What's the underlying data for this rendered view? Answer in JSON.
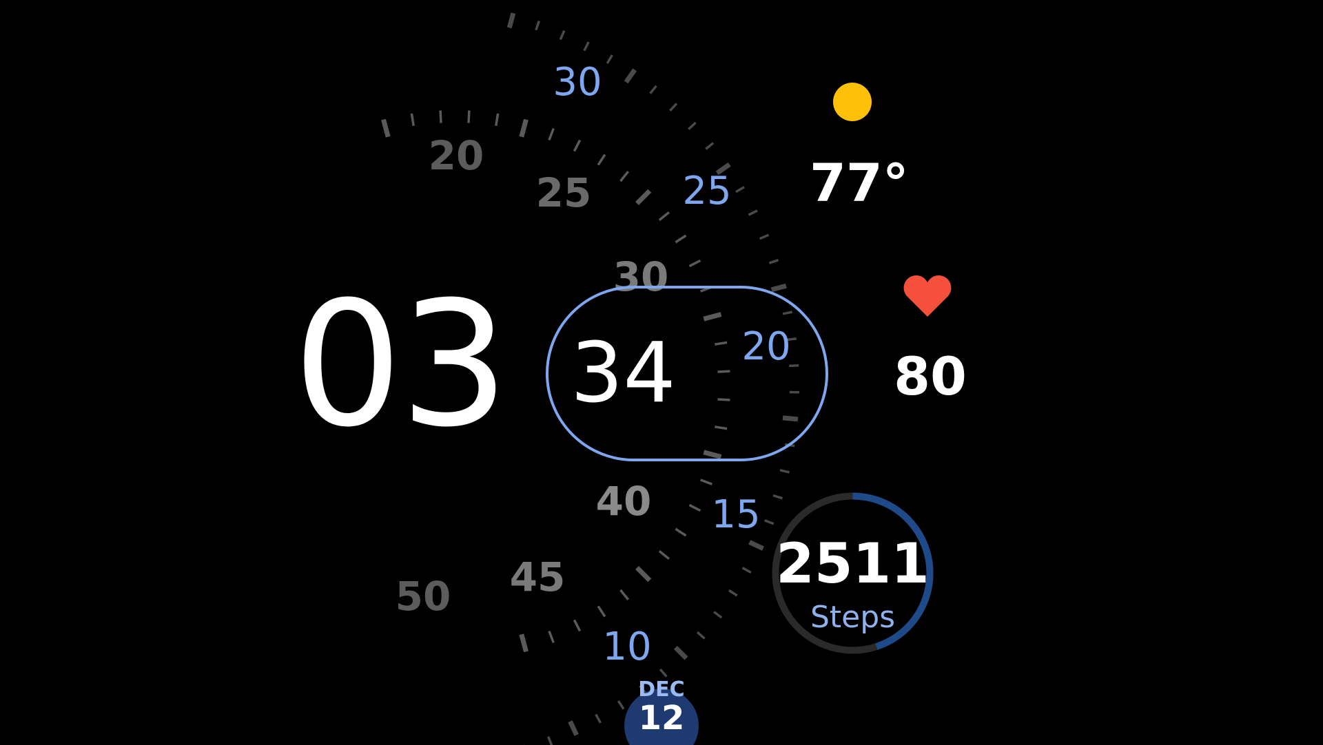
{
  "time": {
    "hour": "03",
    "minute": "34"
  },
  "date": {
    "month": "DEC",
    "day": "12"
  },
  "weather": {
    "icon": "sun-icon",
    "temperature": "77°"
  },
  "heart_rate": {
    "icon": "heart-icon",
    "value": "80"
  },
  "steps": {
    "count": "2511",
    "label": "Steps",
    "progress": 0.45
  },
  "dial": {
    "minute_labels": [
      "20",
      "25",
      "30",
      "40",
      "45",
      "50"
    ],
    "second_labels": [
      "30",
      "25",
      "20",
      "15",
      "10"
    ]
  },
  "colors": {
    "background": "#000000",
    "accent": "#7ea7f0",
    "sun": "#ffc107",
    "heart": "#f4503c",
    "ring_track": "#2a2a2a",
    "ring_progress": "#1f4a8a",
    "date_badge": "#1f3a70",
    "dial_gray": "#5a5a5a"
  }
}
